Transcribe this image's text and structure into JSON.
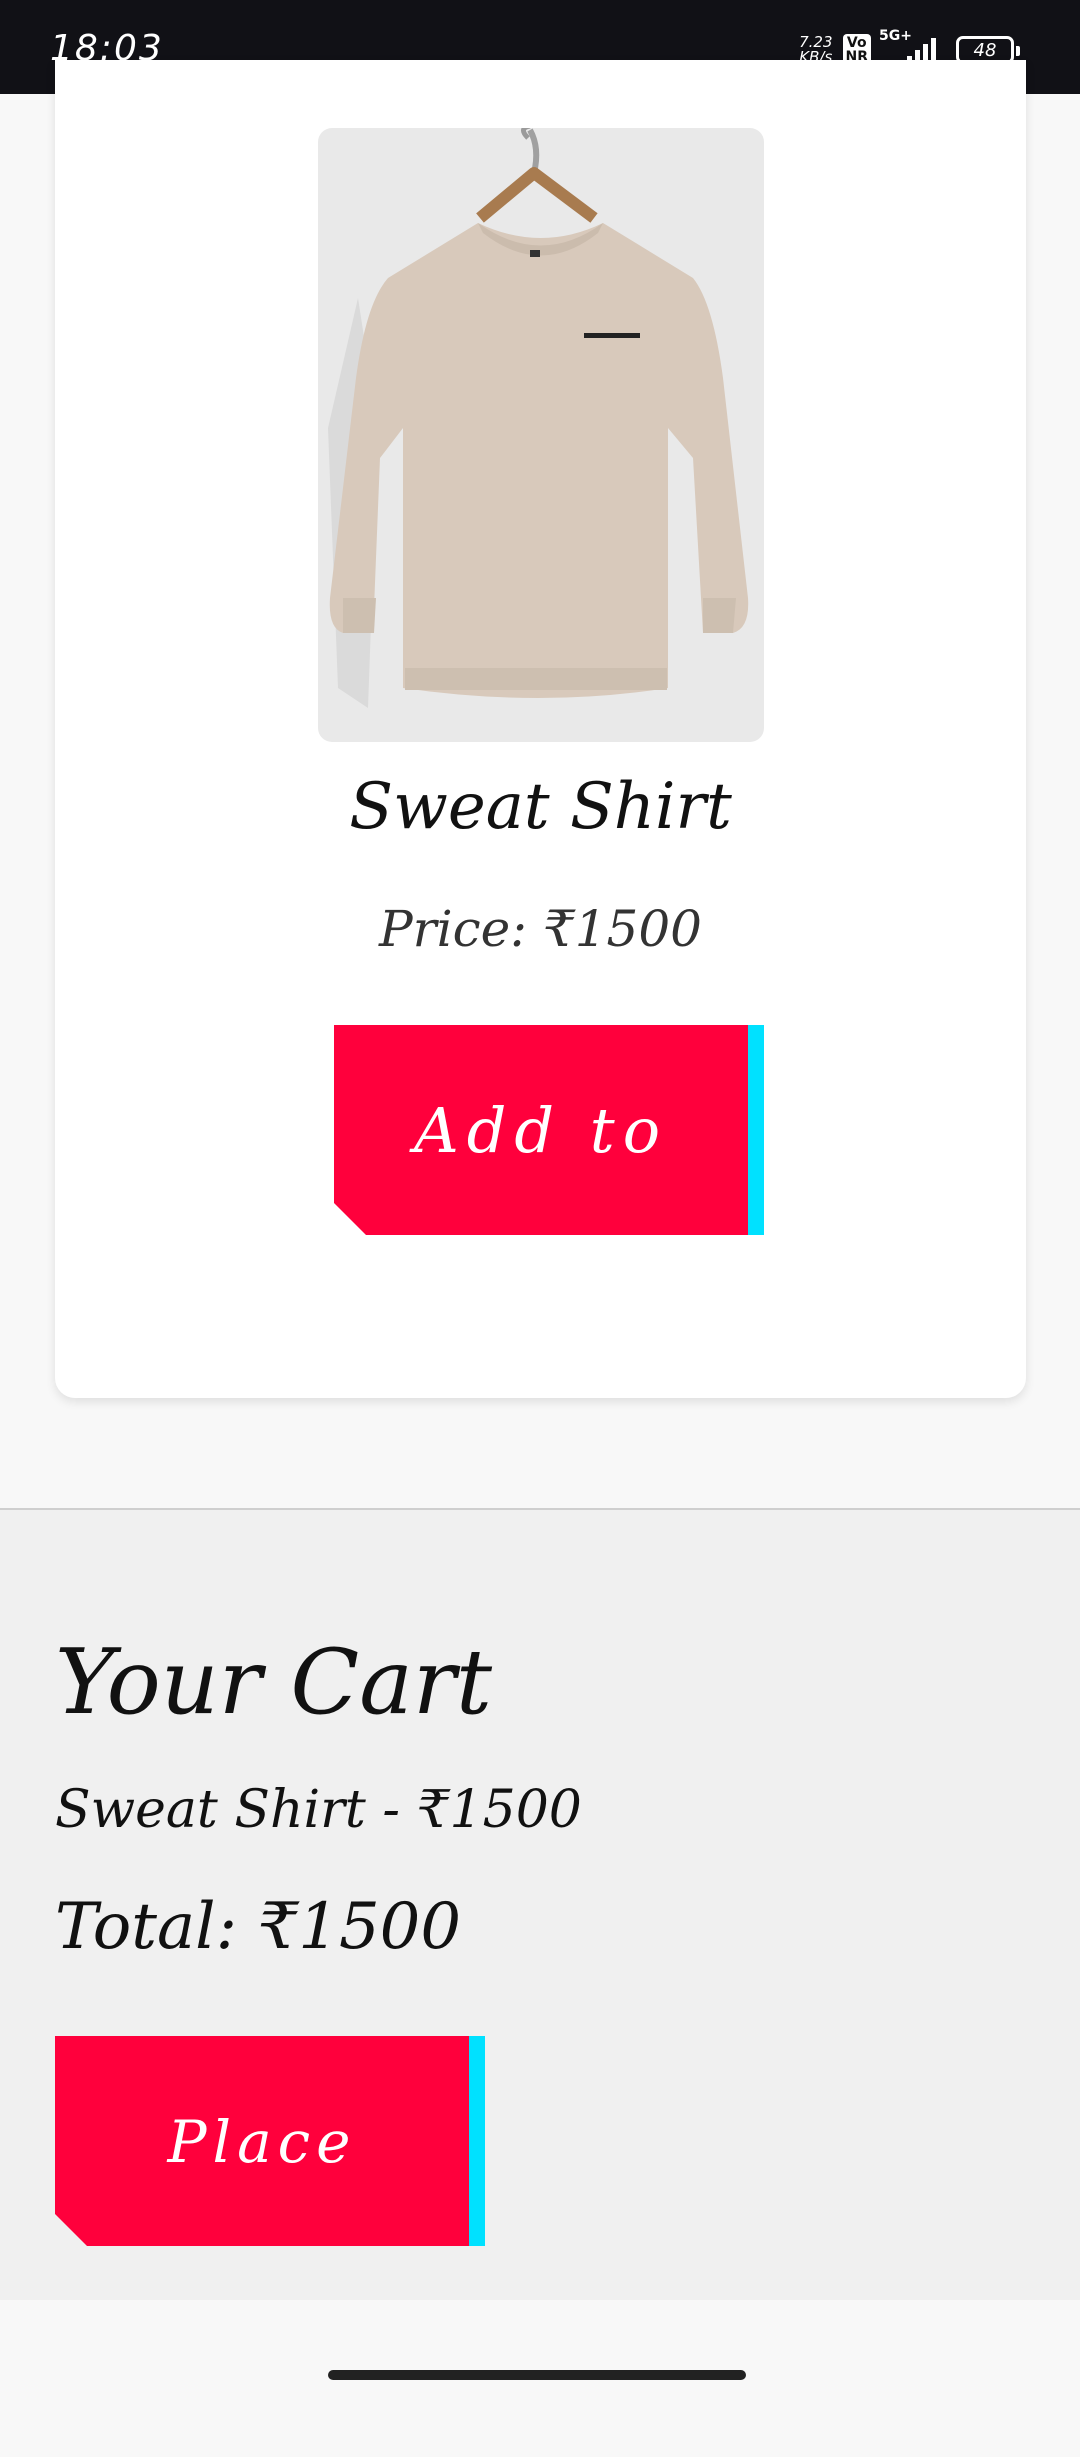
{
  "status_bar": {
    "time": "18:03",
    "net_speed_value": "7.23",
    "net_speed_unit": "KB/s",
    "volte_top": "Vo",
    "volte_bottom": "NR",
    "network_type": "5G+",
    "battery": "48"
  },
  "product": {
    "image_icon": "sweatshirt-image",
    "title": "Sweat Shirt",
    "price": "Price: ₹1500",
    "add_button": "Add to"
  },
  "cart": {
    "title": "Your Cart",
    "items": [
      "Sweat Shirt - ₹1500"
    ],
    "total": "Total: ₹1500",
    "place_order_button": "Place Order"
  },
  "colors": {
    "button": "#ff003c",
    "button_accent": "#00e1ff"
  }
}
